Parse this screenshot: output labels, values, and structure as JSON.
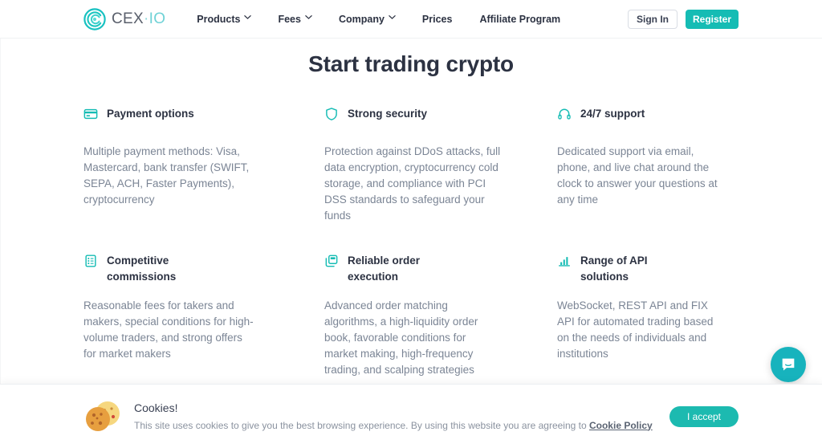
{
  "header": {
    "logo": {
      "brand": "CEX",
      "separator": "·",
      "suffix": "IO",
      "icon": "cex-circle-logo"
    },
    "nav": [
      {
        "label": "Products",
        "has_dropdown": true
      },
      {
        "label": "Fees",
        "has_dropdown": true
      },
      {
        "label": "Company",
        "has_dropdown": true
      },
      {
        "label": "Prices",
        "has_dropdown": false
      },
      {
        "label": "Affiliate Program",
        "has_dropdown": false
      }
    ],
    "sign_in_label": "Sign In",
    "register_label": "Register"
  },
  "main": {
    "title": "Start trading crypto",
    "features": [
      {
        "icon": "credit-card-icon",
        "title": "Payment options",
        "body": "Multiple payment methods: Visa, Mastercard, bank transfer (SWIFT, SEPA, ACH, Faster Payments), cryptocurrency"
      },
      {
        "icon": "shield-icon",
        "title": "Strong security",
        "body": "Protection against DDoS attacks, full data encryption, cryptocurrency cold storage, and compliance with PCI DSS standards to safeguard your funds"
      },
      {
        "icon": "headset-icon",
        "title": "24/7 support",
        "body": "Dedicated support via email, phone, and live chat around the clock to answer your questions at any time"
      },
      {
        "icon": "document-list-icon",
        "title": "Competitive commissions",
        "body": "Reasonable fees for takers and makers, special conditions for high-volume traders, and strong offers for market makers"
      },
      {
        "icon": "copy-squares-icon",
        "title": "Reliable order execution",
        "body": "Advanced order matching algorithms, a high-liquidity order book, favorable conditions for market making, high-frequency trading, and scalping strategies"
      },
      {
        "icon": "bar-chart-icon",
        "title": "Range of API solutions",
        "body": "WebSocket, REST API and FIX API for automated trading based on the needs of individuals and institutions"
      }
    ]
  },
  "chat": {
    "icon": "chat-bubble-icon",
    "label": "Open live chat"
  },
  "cookie_banner": {
    "icon": "cookie-icon",
    "title": "Cookies!",
    "text_before": "This site uses cookies to give you the best browsing experience. By using this website you are agreeing to ",
    "link_label": "Cookie Policy",
    "accept_label": "I accept"
  },
  "colors": {
    "accent_teal": "#15bcb4",
    "accent_teal_alt": "#1cbab0",
    "chat_teal": "#17b3bd",
    "heading": "#2c3242",
    "body_text": "#7b8595",
    "border": "#d9dde4",
    "cookie_brown": "#e3a03c"
  }
}
